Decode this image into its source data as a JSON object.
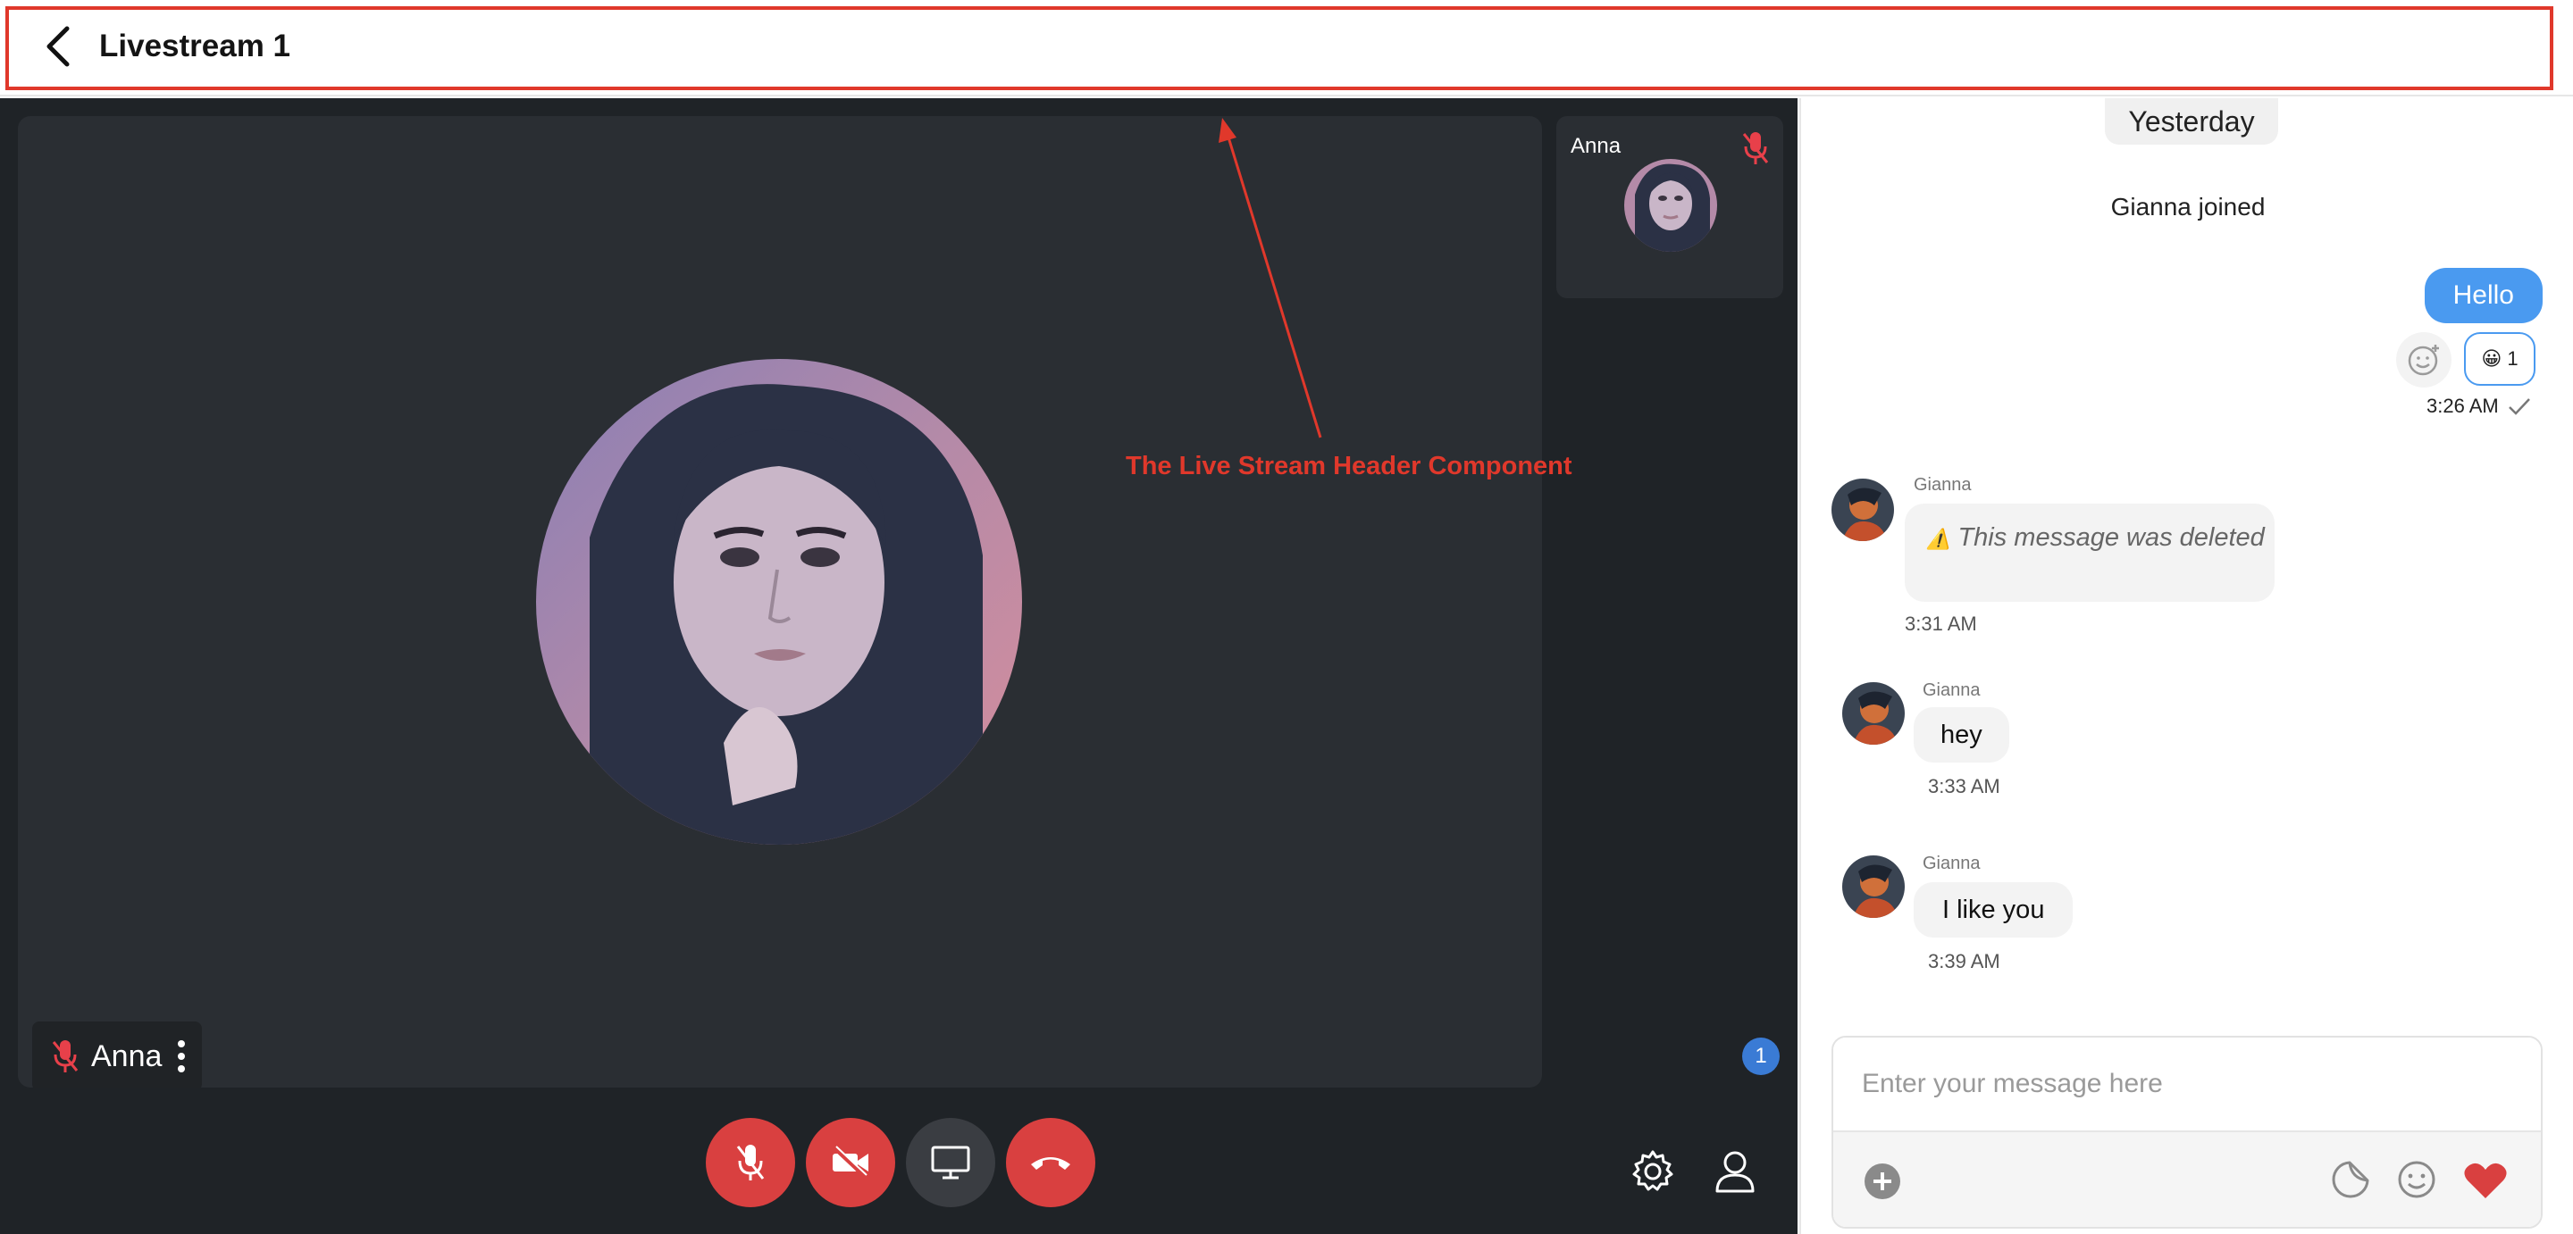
{
  "header": {
    "title": "Livestream 1"
  },
  "call": {
    "main_tile_name": "Anna",
    "side_tile_name": "Anna",
    "participants_count": "1"
  },
  "annotation": {
    "label": "The Live Stream Header Component"
  },
  "chat": {
    "date_separator": "Yesterday",
    "system_message": "Gianna joined",
    "outgoing": {
      "text": "Hello",
      "reaction_emoji": "😀",
      "reaction_count": "1",
      "time": "3:26 AM"
    },
    "incoming": [
      {
        "sender": "Gianna",
        "warning_icon": "⚠️",
        "text": "This message was deleted",
        "time": "3:31 AM"
      },
      {
        "sender": "Gianna",
        "text": "hey",
        "time": "3:33 AM"
      },
      {
        "sender": "Gianna",
        "text": "I like you",
        "time": "3:39 AM"
      }
    ]
  },
  "composer": {
    "placeholder": "Enter your message here"
  },
  "colors": {
    "accent": "#4a9af0",
    "danger": "#d94040",
    "annotation": "#e0382b",
    "call_background": "#1f2327"
  }
}
